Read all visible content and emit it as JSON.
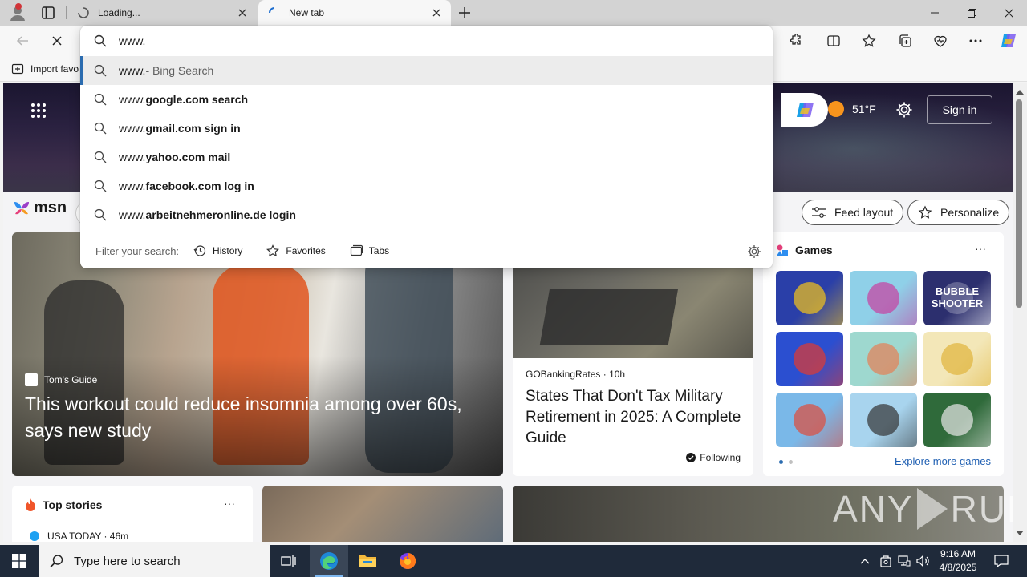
{
  "browser": {
    "tabs": [
      {
        "title": "Loading...",
        "state": "loading"
      },
      {
        "title": "New tab",
        "state": "active"
      }
    ],
    "window_controls": [
      "minimize",
      "restore",
      "close"
    ]
  },
  "toolbar": {
    "back_icon": "arrow-left-icon",
    "stop_icon": "close-icon",
    "right_icons": [
      "extensions-icon",
      "split-screen-icon",
      "favorites-icon",
      "collections-icon",
      "browser-essentials-icon",
      "more-icon",
      "copilot-icon"
    ]
  },
  "favorites_bar": {
    "import_label": "Import favo"
  },
  "omnibox": {
    "value": "www.",
    "suggestions": [
      {
        "base": "www.",
        "rest": "",
        "aux": " - Bing Search",
        "selected": true
      },
      {
        "base": "www.",
        "rest": "google.com search",
        "aux": "",
        "selected": false
      },
      {
        "base": "www.",
        "rest": "gmail.com sign in",
        "aux": "",
        "selected": false
      },
      {
        "base": "www.",
        "rest": "yahoo.com mail",
        "aux": "",
        "selected": false
      },
      {
        "base": "www.",
        "rest": "facebook.com log in",
        "aux": "",
        "selected": false
      },
      {
        "base": "www.",
        "rest": "arbeitnehmeronline.de login",
        "aux": "",
        "selected": false
      }
    ],
    "filter_label": "Filter your search:",
    "filters": [
      "History",
      "Favorites",
      "Tabs"
    ]
  },
  "msn": {
    "logo_text": "msn",
    "weather": "51°F",
    "sign_in": "Sign in",
    "feed_layout": "Feed layout",
    "personalize": "Personalize",
    "hero": {
      "source": "Tom's Guide",
      "headline": "This workout could reduce insomnia among over 60s, says new study"
    },
    "mid_story": {
      "source": "GOBankingRates",
      "age": "· 10h",
      "headline": "States That Don't Tax Military Retirement in 2025: A Complete Guide",
      "following": "Following"
    },
    "games": {
      "title": "Games",
      "more": "···",
      "explore": "Explore more games",
      "tiles": [
        {
          "name": "jewel-match",
          "color": "#2a3fa8",
          "accent": "#f5c518"
        },
        {
          "name": "makeup-brushes",
          "color": "#8fd0e8",
          "accent": "#c83fa0"
        },
        {
          "name": "bubble-shooter",
          "color": "#2c2f6e",
          "accent": "#ffffff",
          "label": "BUBBLE SHOOTER"
        },
        {
          "name": "block-puzzle",
          "color": "#2b4fd0",
          "accent": "#e23a2f"
        },
        {
          "name": "hospital-sim",
          "color": "#9ed8cf",
          "accent": "#e57f54"
        },
        {
          "name": "doge-meme",
          "color": "#f3e7b8",
          "accent": "#e0b43a"
        },
        {
          "name": "restaurant-rush",
          "color": "#7ab8e8",
          "accent": "#e04b3b"
        },
        {
          "name": "thief-puzzle",
          "color": "#a8d4ee",
          "accent": "#333333"
        },
        {
          "name": "mahjong",
          "color": "#2f6a3a",
          "accent": "#e8e8e8"
        }
      ]
    },
    "top_stories": {
      "title": "Top stories",
      "more": "···",
      "first_source": "USA TODAY · 46m"
    }
  },
  "watermark": {
    "left": "ANY",
    "right": "RUN"
  },
  "taskbar": {
    "search_placeholder": "Type here to search",
    "apps": [
      "task-view-icon",
      "edge-icon",
      "file-explorer-icon",
      "firefox-icon"
    ],
    "time": "9:16 AM",
    "date": "4/8/2025"
  },
  "colors": {
    "accent": "#2b6cb0",
    "taskbar": "#1f2a3a",
    "hero_dark": "#2a2140"
  }
}
